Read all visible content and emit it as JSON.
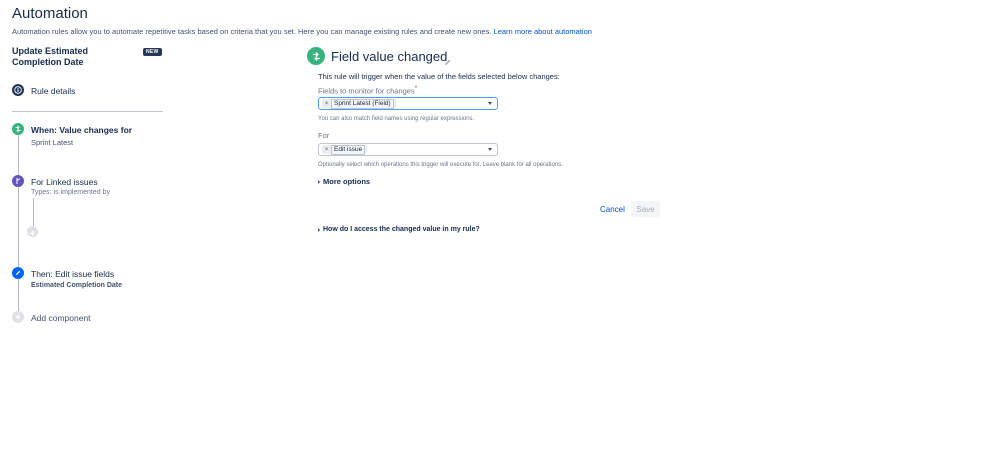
{
  "header": {
    "title": "Automation",
    "subtitle": "Automation rules allow you to automate repetitive tasks based on criteria that you set. Here you can manage existing rules and create new ones.",
    "learn_more": "Learn more about automation"
  },
  "rule": {
    "name": "Update Estimated Completion Date",
    "badge": "NEW"
  },
  "sidebar": {
    "rule_details": "Rule details",
    "trigger": {
      "title": "When: Value changes for",
      "subtitle": "Sprint Latest"
    },
    "branch": {
      "title": "For Linked issues",
      "subtitle": "Types: is implemented by"
    },
    "action": {
      "title": "Then: Edit issue fields",
      "subtitle": "Estimated Completion Date"
    },
    "add_component": "Add component"
  },
  "panel": {
    "title": "Field value changed",
    "description": "This rule will trigger when the value of the fields selected below changes:",
    "fields_label": "Fields to monitor for changes",
    "required_mark": "*",
    "fields_value": "Sprint Latest (Field)",
    "fields_help": "You can also match field names using regular expressions.",
    "for_label": "For",
    "for_value": "Edit issue",
    "for_help": "Optionally select which operations this trigger will execute for. Leave blank for all operations.",
    "more_options": "More options",
    "cancel": "Cancel",
    "save": "Save",
    "how_do_i": "How do I access the changed value in my rule?"
  },
  "colors": {
    "trigger": "#36b37e",
    "branch": "#6554c0",
    "action": "#0065ff",
    "link": "#0052cc",
    "focus": "#4c9aff"
  },
  "icons": {
    "rule_details": "info-icon",
    "trigger": "trigger-icon",
    "branch": "branch-icon",
    "action": "pencil-icon",
    "add": "plus-icon",
    "edit_title": "pencil-icon"
  }
}
